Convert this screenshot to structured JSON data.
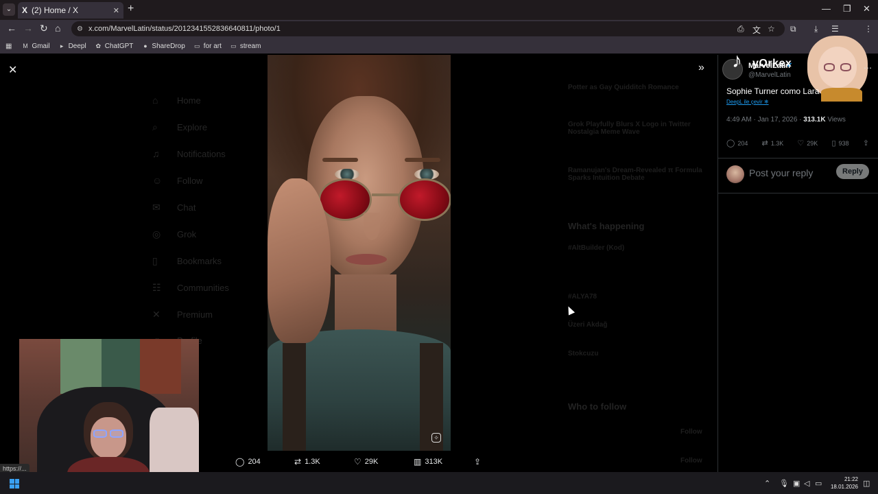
{
  "browser": {
    "tab_title": "(2) Home / X",
    "tab_logo": "X",
    "url": "x.com/MarvelLatin/status/2012341552836640811/photo/1",
    "status_url": "https://...",
    "bookmarks": [
      {
        "label": "Gmail",
        "icon": "gmail-icon"
      },
      {
        "label": "Deepl",
        "icon": "deepl-icon"
      },
      {
        "label": "ChatGPT",
        "icon": "chatgpt-icon"
      },
      {
        "label": "ShareDrop",
        "icon": "sharedrop-icon"
      },
      {
        "label": "for art",
        "icon": "folder-icon"
      },
      {
        "label": "stream",
        "icon": "folder-icon"
      }
    ]
  },
  "background_nav": [
    "Home",
    "Explore",
    "Notifications",
    "Follow",
    "Chat",
    "Grok",
    "Bookmarks",
    "Communities",
    "Premium",
    "Profile"
  ],
  "background_right": {
    "items": [
      "Potter as Gay Quidditch Romance",
      "Grok Playfully Blurs X Logo in Twitter Nostalgia Meme Wave",
      "Ramanujan's Dream-Revealed π Formula Sparks Intuition Debate"
    ],
    "whats_happening": "What's happening",
    "trends": [
      "#AltBuilder (Kod)",
      "#ALYA78",
      "Üzeri Akdağ",
      "Stokcuzu"
    ],
    "who_to_follow": "Who to follow",
    "follow_label": "Follow"
  },
  "media_actions": {
    "replies": "204",
    "reposts": "1.3K",
    "likes": "29K",
    "views": "313K"
  },
  "tweet": {
    "author_name": "MarvelLatin",
    "author_handle": "@MarvelLatin",
    "text": "Sophie Turner como Lara",
    "translate_link": "DeepL ile çevir",
    "time": "4:49 AM · Jan 17, 2026 · ",
    "views_count": "313.1K",
    "views_label": " Views",
    "replies": "204",
    "reposts": "1.3K",
    "likes": "29K",
    "bookmarks": "938",
    "reply_placeholder": "Post your reply",
    "reply_button": "Reply"
  },
  "stream_overlay": {
    "name": "yOrkex"
  },
  "taskbar": {
    "time": "21:22",
    "date": "18.01.2026"
  },
  "colors": {
    "accent": "#1d9bf0",
    "lens": "#a5101e",
    "reply_button": "#787a7a"
  }
}
